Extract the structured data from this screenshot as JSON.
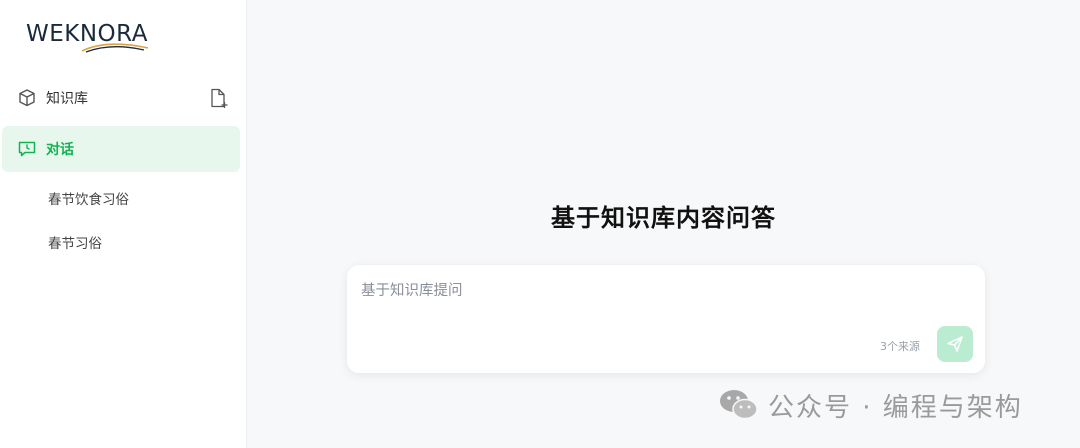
{
  "brand": {
    "logo_text": "WEKNORA"
  },
  "sidebar": {
    "items": [
      {
        "label": "知识库",
        "icon": "cube-icon"
      },
      {
        "label": "对话",
        "icon": "chat-icon",
        "active": true
      }
    ],
    "add_doc_icon": "file-plus-icon",
    "conversations": [
      {
        "title": "春节饮食习俗"
      },
      {
        "title": "春节习俗"
      }
    ]
  },
  "main": {
    "title": "基于知识库内容问答",
    "composer": {
      "placeholder": "基于知识库提问",
      "value": "",
      "source_count": "3个来源",
      "send_icon": "send-icon"
    }
  },
  "watermark": {
    "text": "公众号 · 编程与架构"
  },
  "colors": {
    "accent": "#10b350",
    "active_bg": "#e8f7ee",
    "send_bg": "#b9ecd0",
    "sidebar_bg": "#ffffff",
    "main_bg": "#f7f8fa"
  }
}
